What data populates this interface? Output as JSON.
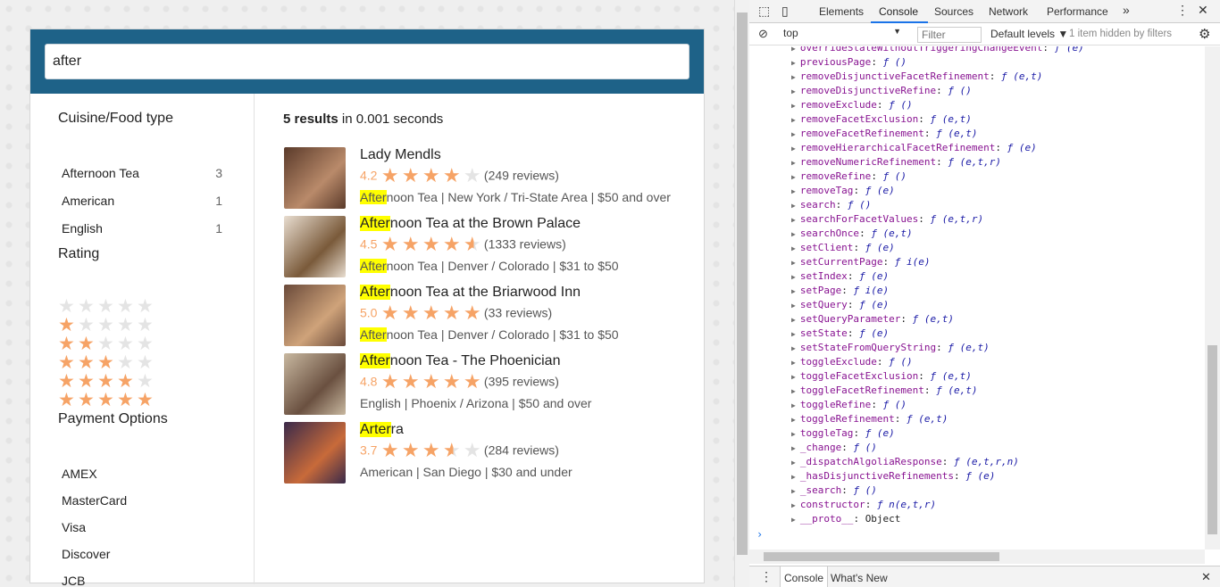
{
  "search": {
    "value": "after"
  },
  "sidebar": {
    "cuisine": {
      "title": "Cuisine/Food type",
      "items": [
        {
          "label": "Afternoon Tea",
          "count": "3"
        },
        {
          "label": "American",
          "count": "1"
        },
        {
          "label": "English",
          "count": "1"
        }
      ]
    },
    "rating": {
      "title": "Rating",
      "rows": [
        0,
        1,
        2,
        3,
        4,
        5
      ]
    },
    "payment": {
      "title": "Payment Options",
      "items": [
        "AMEX",
        "MasterCard",
        "Visa",
        "Discover",
        "JCB"
      ]
    }
  },
  "results": {
    "stats_count": "5 results",
    "stats_time": " in 0.001 seconds",
    "hits": [
      {
        "highlight": "",
        "name_rest": "Lady Mendls",
        "score": "4.2",
        "stars": 4,
        "reviews": "(249 reviews)",
        "meta_highlight": "After",
        "meta_rest": "noon Tea | New York / Tri-State Area | $50 and over"
      },
      {
        "highlight": "After",
        "name_rest": "noon Tea at the Brown Palace",
        "score": "4.5",
        "stars": 4.5,
        "reviews": "(1333 reviews)",
        "meta_highlight": "After",
        "meta_rest": "noon Tea | Denver / Colorado | $31 to $50"
      },
      {
        "highlight": "After",
        "name_rest": "noon Tea at the Briarwood Inn",
        "score": "5.0",
        "stars": 5,
        "reviews": "(33 reviews)",
        "meta_highlight": "After",
        "meta_rest": "noon Tea | Denver / Colorado | $31 to $50"
      },
      {
        "highlight": "After",
        "name_rest": "noon Tea - The Phoenician",
        "score": "4.8",
        "stars": 5,
        "reviews": "(395 reviews)",
        "meta_highlight": "",
        "meta_rest": "English | Phoenix / Arizona | $50 and over"
      },
      {
        "highlight": "Arter",
        "name_rest": "ra",
        "score": "3.7",
        "stars": 3.5,
        "reviews": "(284 reviews)",
        "meta_highlight": "",
        "meta_rest": "American | San Diego | $30 and under"
      }
    ]
  },
  "devtools": {
    "tabs": [
      "Elements",
      "Console",
      "Sources",
      "Network",
      "Performance"
    ],
    "more": "»",
    "context": "top",
    "filter_placeholder": "Filter",
    "levels": "Default levels ▼",
    "hidden": "1 item hidden by filters",
    "lines": [
      [
        "overrideStateWithoutTriggeringChangeEvent",
        "ƒ (e)"
      ],
      [
        "previousPage",
        "ƒ ()"
      ],
      [
        "removeDisjunctiveFacetRefinement",
        "ƒ (e,t)"
      ],
      [
        "removeDisjunctiveRefine",
        "ƒ ()"
      ],
      [
        "removeExclude",
        "ƒ ()"
      ],
      [
        "removeFacetExclusion",
        "ƒ (e,t)"
      ],
      [
        "removeFacetRefinement",
        "ƒ (e,t)"
      ],
      [
        "removeHierarchicalFacetRefinement",
        "ƒ (e)"
      ],
      [
        "removeNumericRefinement",
        "ƒ (e,t,r)"
      ],
      [
        "removeRefine",
        "ƒ ()"
      ],
      [
        "removeTag",
        "ƒ (e)"
      ],
      [
        "search",
        "ƒ ()"
      ],
      [
        "searchForFacetValues",
        "ƒ (e,t,r)"
      ],
      [
        "searchOnce",
        "ƒ (e,t)"
      ],
      [
        "setClient",
        "ƒ (e)"
      ],
      [
        "setCurrentPage",
        "ƒ i(e)"
      ],
      [
        "setIndex",
        "ƒ (e)"
      ],
      [
        "setPage",
        "ƒ i(e)"
      ],
      [
        "setQuery",
        "ƒ (e)"
      ],
      [
        "setQueryParameter",
        "ƒ (e,t)"
      ],
      [
        "setState",
        "ƒ (e)"
      ],
      [
        "setStateFromQueryString",
        "ƒ (e,t)"
      ],
      [
        "toggleExclude",
        "ƒ ()"
      ],
      [
        "toggleFacetExclusion",
        "ƒ (e,t)"
      ],
      [
        "toggleFacetRefinement",
        "ƒ (e,t)"
      ],
      [
        "toggleRefine",
        "ƒ ()"
      ],
      [
        "toggleRefinement",
        "ƒ (e,t)"
      ],
      [
        "toggleTag",
        "ƒ (e)"
      ],
      [
        "_change",
        "ƒ ()"
      ],
      [
        "_dispatchAlgoliaResponse",
        "ƒ (e,t,r,n)"
      ],
      [
        "_hasDisjunctiveRefinements",
        "ƒ (e)"
      ],
      [
        "_search",
        "ƒ ()"
      ],
      [
        "constructor",
        "ƒ n(e,t,r)"
      ],
      [
        "__proto__",
        "Object"
      ]
    ],
    "prompt": "›",
    "drawer_tabs": [
      "Console",
      "What's New"
    ]
  }
}
